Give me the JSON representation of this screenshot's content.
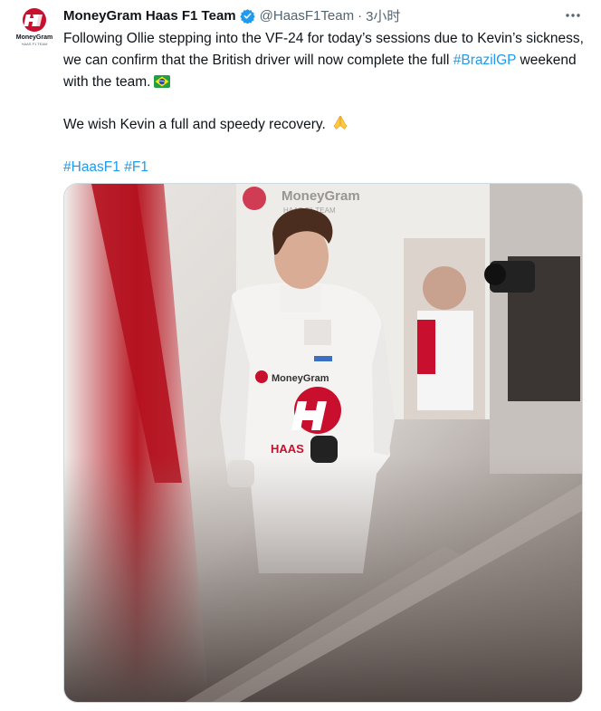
{
  "author": {
    "display_name": "MoneyGram Haas F1 Team",
    "handle": "@HaasF1Team",
    "separator": "·",
    "time": "3小时",
    "avatar_text": "MoneyGram",
    "avatar_subtext": "HAAS F1 TEAM"
  },
  "tweet": {
    "para1": "Following Ollie stepping into the VF-24 for today’s sessions due to Kevin’s sickness, we can confirm that the British driver will now complete the full ",
    "para1_tag": "#BrazilGP",
    "para1_end": " weekend with the team.",
    "para2": "We wish Kevin a full and speedy recovery.",
    "hashtags": [
      "#HaasF1",
      "#F1"
    ]
  },
  "icons": {
    "verified": "verified-badge-icon",
    "more": "more-options-icon",
    "flag": "brazil-flag-emoji",
    "pray": "folded-hands-emoji"
  },
  "photo": {
    "banner_text": "MoneyGram",
    "banner_subtext": "HAAS F1 TEAM",
    "suit_brand": "MoneyGram",
    "suit_logo": "HAAS"
  },
  "colors": {
    "link": "#1d9bf0",
    "verified": "#1d9bf0",
    "haas_red": "#c8102e",
    "secondary_text": "#536471"
  }
}
